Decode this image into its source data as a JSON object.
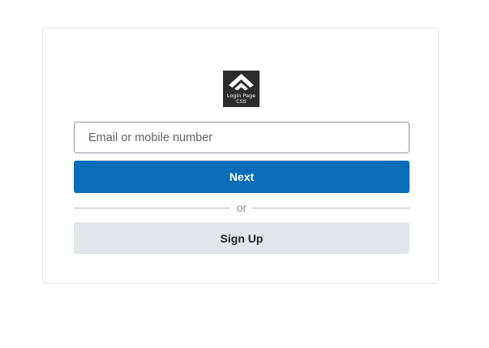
{
  "logo": {
    "icon": "double-chevron-up-icon",
    "line1": "Login Page",
    "line2": "CSS",
    "background": "#2b2b2b"
  },
  "form": {
    "email_placeholder": "Email or mobile number",
    "email_value": "",
    "next_label": "Next",
    "divider_text": "or",
    "signup_label": "Sign Up"
  },
  "colors": {
    "primary": "#0a6dba",
    "secondary": "#e2e6ea",
    "card_border": "#e3e6ea"
  }
}
